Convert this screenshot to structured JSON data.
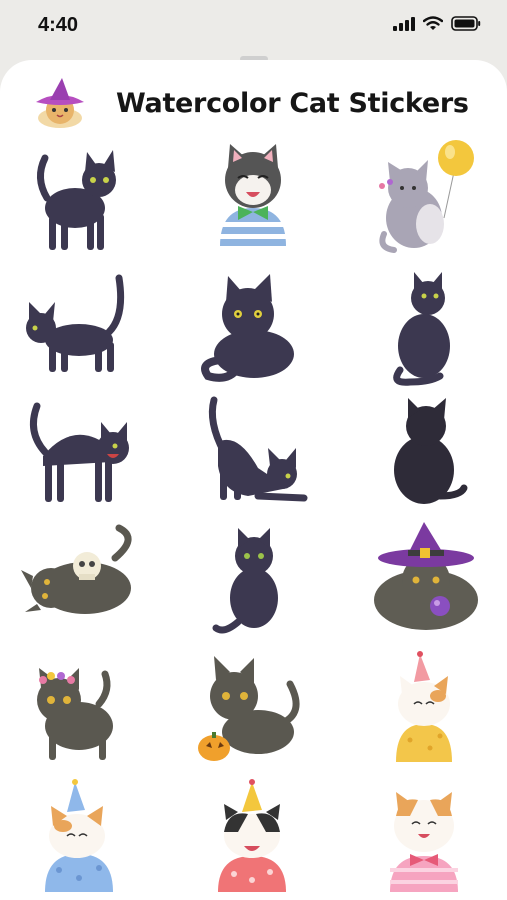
{
  "status": {
    "time": "4:40"
  },
  "header": {
    "title": "Watercolor Cat Stickers"
  },
  "stickers": [
    {
      "name": "black-cat-standing-sticker"
    },
    {
      "name": "tuxedo-cat-bowtie-sticker"
    },
    {
      "name": "grey-cat-balloon-sticker"
    },
    {
      "name": "black-cat-walking-sticker"
    },
    {
      "name": "black-cat-loaf-sticker"
    },
    {
      "name": "black-cat-sitting-side-sticker"
    },
    {
      "name": "black-cat-arched-sticker"
    },
    {
      "name": "black-cat-stretching-sticker"
    },
    {
      "name": "black-cat-back-view-sticker"
    },
    {
      "name": "grey-cat-skull-sticker"
    },
    {
      "name": "black-cat-sitting-front-sticker"
    },
    {
      "name": "grey-cat-witch-hat-sticker"
    },
    {
      "name": "grey-cat-flower-crown-sticker"
    },
    {
      "name": "grey-cat-pumpkin-sticker"
    },
    {
      "name": "calico-cat-party-hat-yellow-sticker"
    },
    {
      "name": "calico-cat-party-hat-blue-sticker"
    },
    {
      "name": "tuxedo-cat-party-hat-red-sticker"
    },
    {
      "name": "orange-cat-bow-pink-sticker"
    }
  ]
}
